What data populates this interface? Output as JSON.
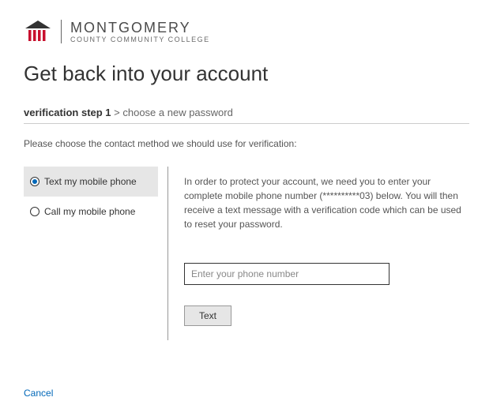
{
  "logo": {
    "top": "MONTGOMERY",
    "bottom": "COUNTY COMMUNITY COLLEGE"
  },
  "title": "Get back into your account",
  "step": {
    "bold": "verification step 1",
    "rest": " > choose a new password"
  },
  "prompt": "Please choose the contact method we should use for verification:",
  "options": {
    "text": "Text my mobile phone",
    "call": "Call my mobile phone"
  },
  "instructions": "In order to protect your account, we need you to enter your complete mobile phone number (**********03) below. You will then receive a text message with a verification code which can be used to reset your password.",
  "phone_placeholder": "Enter your phone number",
  "text_button": "Text",
  "cancel": "Cancel"
}
